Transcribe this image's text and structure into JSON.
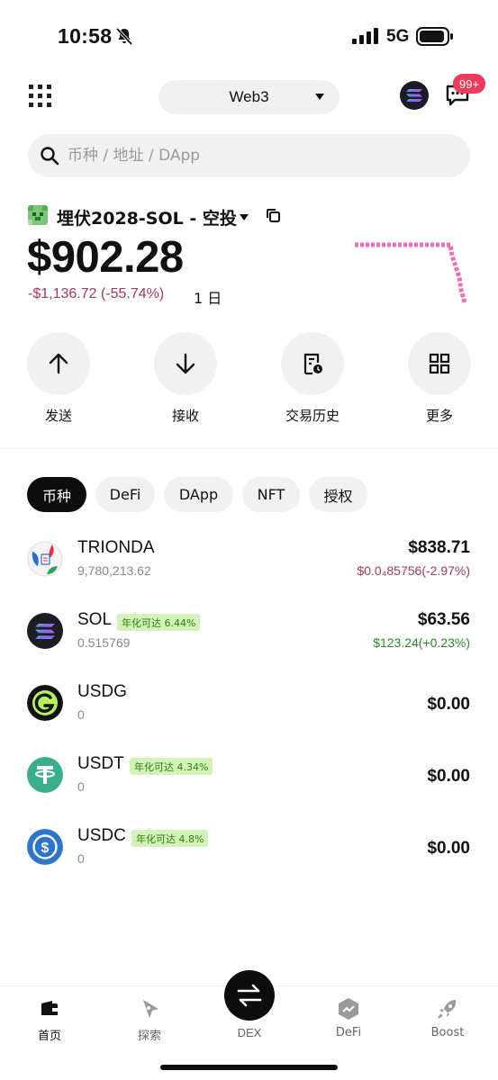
{
  "status_bar": {
    "time": "10:58",
    "network": "5G",
    "battery_level": 0.9
  },
  "header": {
    "network_switch": "Web3",
    "notification_badge": "99+"
  },
  "search": {
    "placeholder": "币种 / 地址 / DApp"
  },
  "wallet": {
    "name": "埋伏2028-SOL - 空投",
    "balance": "$902.28",
    "pnl": "-$1,136.72 (-55.74%)",
    "period": "1 日"
  },
  "actions": [
    {
      "label": "发送",
      "icon": "arrow-up-icon"
    },
    {
      "label": "接收",
      "icon": "arrow-down-icon"
    },
    {
      "label": "交易历史",
      "icon": "history-icon"
    },
    {
      "label": "更多",
      "icon": "grid-icon"
    }
  ],
  "tabs": [
    {
      "label": "币种",
      "active": true
    },
    {
      "label": "DeFi",
      "active": false
    },
    {
      "label": "DApp",
      "active": false
    },
    {
      "label": "NFT",
      "active": false
    },
    {
      "label": "授权",
      "active": false
    }
  ],
  "assets": [
    {
      "name": "TRIONDA",
      "amount": "9,780,213.62",
      "value": "$838.71",
      "change": "$0.0₄85756(-2.97%)",
      "trend": "negative",
      "apr": "",
      "icon": "trionda-ball-icon"
    },
    {
      "name": "SOL",
      "amount": "0.515769",
      "value": "$63.56",
      "change": "$123.24(+0.23%)",
      "trend": "positive",
      "apr": "年化可达 6.44%",
      "icon": "solana-icon"
    },
    {
      "name": "USDG",
      "amount": "0",
      "value": "$0.00",
      "change": "",
      "trend": "",
      "apr": "",
      "icon": "usdg-icon"
    },
    {
      "name": "USDT",
      "amount": "0",
      "value": "$0.00",
      "change": "",
      "trend": "",
      "apr": "年化可达 4.34%",
      "icon": "tether-icon"
    },
    {
      "name": "USDC",
      "amount": "0",
      "value": "$0.00",
      "change": "",
      "trend": "",
      "apr": "年化可达 4.8%",
      "icon": "usdc-icon"
    }
  ],
  "bottom_nav": [
    {
      "label": "首页",
      "icon": "wallet-icon",
      "active": true
    },
    {
      "label": "探索",
      "icon": "compass-icon",
      "active": false
    },
    {
      "label": "DEX",
      "icon": "swap-icon",
      "active": false
    },
    {
      "label": "DeFi",
      "icon": "defi-icon",
      "active": false
    },
    {
      "label": "Boost",
      "icon": "rocket-icon",
      "active": false
    }
  ],
  "colors": {
    "negative": "#a33a62",
    "positive": "#2c8a2c",
    "badge": "#ee3a5b",
    "sparkline": "#f06fb8",
    "apr_bg": "#d4f2b8"
  }
}
